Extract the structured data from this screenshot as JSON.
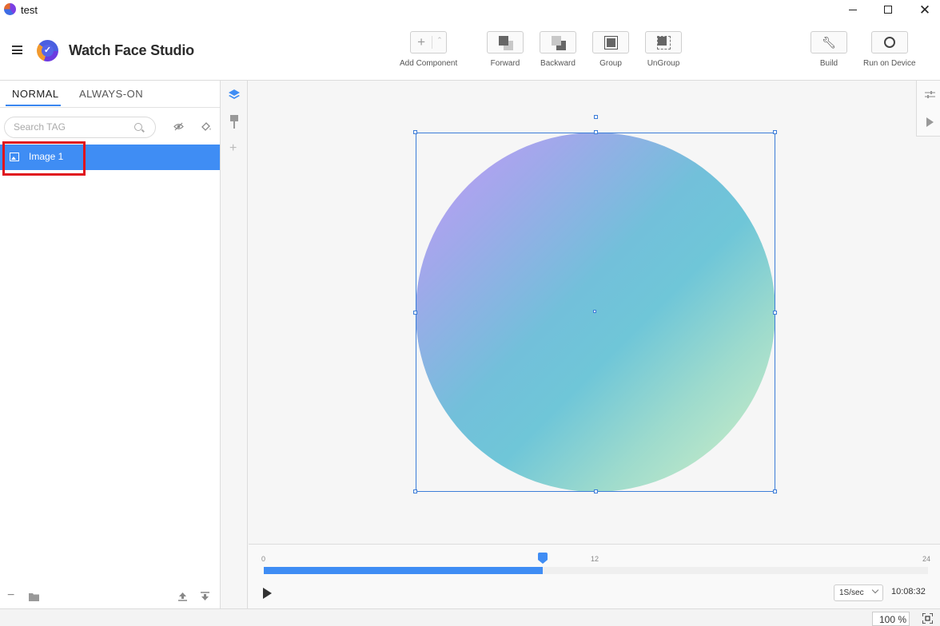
{
  "window": {
    "title": "test"
  },
  "header": {
    "app_name": "Watch Face Studio",
    "tools": [
      {
        "label": "Add Component",
        "icon": "plus-icon"
      },
      {
        "label": "Forward",
        "icon": "bring-forward-icon"
      },
      {
        "label": "Backward",
        "icon": "send-backward-icon"
      },
      {
        "label": "Group",
        "icon": "group-icon"
      },
      {
        "label": "UnGroup",
        "icon": "ungroup-icon"
      },
      {
        "label": "Build",
        "icon": "wrench-icon"
      },
      {
        "label": "Run on Device",
        "icon": "watch-icon"
      }
    ]
  },
  "left_panel": {
    "tabs": [
      {
        "label": "NORMAL",
        "active": true
      },
      {
        "label": "ALWAYS-ON",
        "active": false
      }
    ],
    "search": {
      "placeholder": "Search TAG",
      "value": ""
    },
    "layers": [
      {
        "name": "Image 1",
        "selected": true,
        "icon": "image-icon"
      }
    ]
  },
  "canvas": {
    "gradient_colors": [
      "#c49af8",
      "#72c0da",
      "#d6f2c6"
    ]
  },
  "timeline": {
    "ticks": [
      "0",
      "12",
      "24"
    ],
    "progress": 0.42,
    "speed": "1S/sec",
    "time": "10:08:32"
  },
  "statusbar": {
    "zoom": "100 %"
  },
  "colors": {
    "accent": "#3f8df4",
    "highlight": "#e0141e"
  }
}
